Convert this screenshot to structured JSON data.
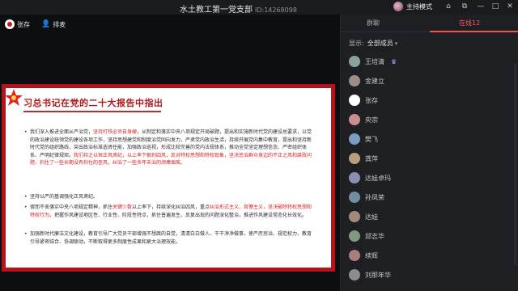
{
  "window": {
    "title": "水土教工第一党支部",
    "room_id": "ID:14268098",
    "host_mode_label": "主持模式",
    "controls": [
      "⌂",
      "⧉",
      "—",
      "□",
      "✕"
    ]
  },
  "stage": {
    "speakers": [
      {
        "name": "张存"
      },
      {
        "name": "排麦"
      }
    ]
  },
  "slide": {
    "title": "习总书记在党的二十大报告中指出",
    "paragraphs": [
      {
        "segments": [
          {
            "t": "我们深入推进全面从严治党，",
            "red": false
          },
          {
            "t": "坚持打铁必须自身硬",
            "red": true
          },
          {
            "t": "，从制定和落实中央八项规定开局破题，提出和实施新时代党的建设总要求，以党的政治建设统领党的建设各项工作，坚持思想建党和制度治党同向发力，严肃党内政治生活，持续开展党内集中教育，提出和坚持新时代党的组织路线，突出政治标准选贤任能，加强政治巡视，形成比较完善的党内法规体系，推动全党坚定理想信念、严密组织体系、严明纪律规矩。",
            "red": false
          },
          {
            "t": "我们持之以恒正风肃纪，以上率下狠刹四风，反对特权思想和特权现象，坚决惩治群众身边的不正之风和腐败问题，刹住了一些长期没有刹住的歪风，纠治了一些多年未治的顽瘴痼疾。",
            "red": true
          }
        ]
      },
      {
        "segments": [
          {
            "t": "坚持以严的基调强化正风肃纪。",
            "red": false
          }
        ]
      },
      {
        "segments": [
          {
            "t": "锲而不舍落实中央八项规定精神，抓住",
            "red": false
          },
          {
            "t": "关键少数",
            "red": true
          },
          {
            "t": "以上率下，持续深化纠治四风，重点",
            "red": false
          },
          {
            "t": "纠治形式主义、官僚主义，坚决破除特权思想和特权行为",
            "red": true
          },
          {
            "t": "。把握作风建设地区性、行业性、阶段性特点，抓住普遍发生、反复出现的问题深化整治，推进作风建设常态化长效化。",
            "red": false
          }
        ]
      },
      {
        "segments": [
          {
            "t": "加强新时代廉洁文化建设，教育引导广大党员干部增强不想腐的自觉，清清白白做人、干干净净做事，使严厉惩治、规范权力、教育引导紧密结合、协调联动，不断取得更多制度性成果和更大治理效能。",
            "red": false
          }
        ]
      }
    ]
  },
  "panel": {
    "tabs": [
      "群聊",
      "在线12"
    ],
    "active_tab": 1,
    "filter_label": "显示:",
    "filter_value": "全部成员",
    "members": [
      {
        "name": "王培清",
        "color": "#8aa39a",
        "badge": "♛"
      },
      {
        "name": "金建立",
        "color": "#9c8f86",
        "badge": ""
      },
      {
        "name": "张存",
        "color": "#ffffff",
        "badge": ""
      },
      {
        "name": "央宗",
        "color": "#c98f8f",
        "badge": ""
      },
      {
        "name": "樊飞",
        "color": "#7a9ec1",
        "badge": ""
      },
      {
        "name": "龚萍",
        "color": "#b9a07a",
        "badge": ""
      },
      {
        "name": "达娃卓玛",
        "color": "#8b8fb0",
        "badge": ""
      },
      {
        "name": "孙凤荣",
        "color": "#6f8fa0",
        "badge": ""
      },
      {
        "name": "达娃",
        "color": "#a08a7a",
        "badge": ""
      },
      {
        "name": "邱志华",
        "color": "#7f9a7f",
        "badge": ""
      },
      {
        "name": "续辉",
        "color": "#a87f7f",
        "badge": ""
      },
      {
        "name": "刘那年华",
        "color": "#8d8d8d",
        "badge": ""
      }
    ]
  }
}
